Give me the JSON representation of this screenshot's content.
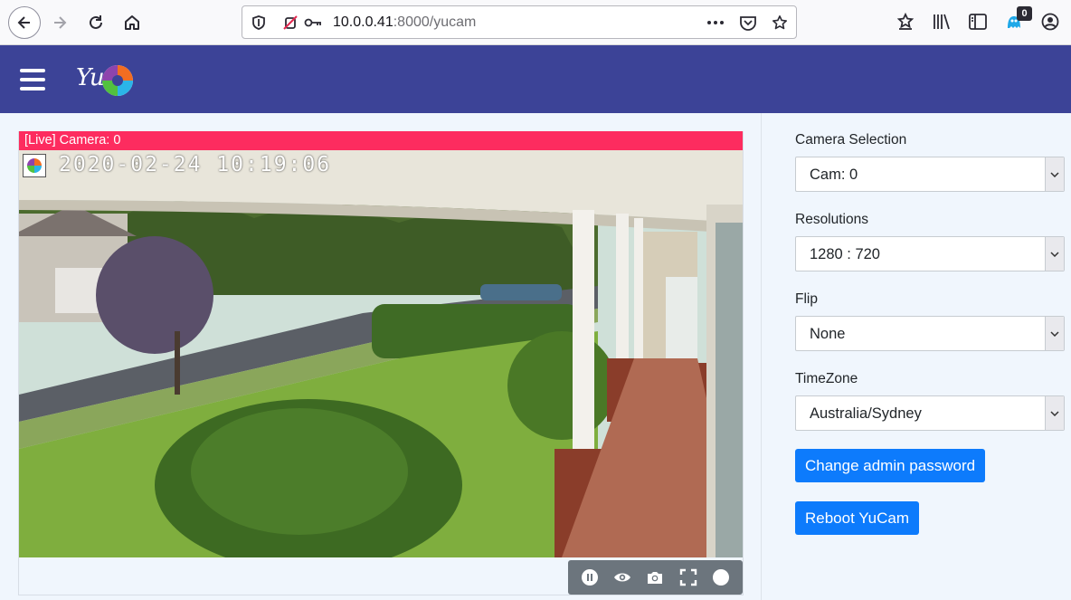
{
  "browser": {
    "url_host": "10.0.0.41",
    "url_path": ":8000/yucam",
    "extension_badge": "0"
  },
  "app": {
    "logo_text": "Yu"
  },
  "camera": {
    "live_label": "[Live] Camera: 0",
    "timestamp": "2020-02-24 10:19:06"
  },
  "sidebar": {
    "camera_selection_label": "Camera Selection",
    "camera_selection_value": "Cam: 0",
    "resolutions_label": "Resolutions",
    "resolutions_value": "1280 : 720",
    "flip_label": "Flip",
    "flip_value": "None",
    "timezone_label": "TimeZone",
    "timezone_value": "Australia/Sydney",
    "change_password_button": "Change admin password",
    "reboot_button": "Reboot YuCam"
  },
  "colors": {
    "appbar": "#3c4397",
    "live_bar": "#fd2c5f",
    "primary_button": "#0d7bfc",
    "controls_bg": "#6c757d"
  },
  "icons": [
    "back-icon",
    "forward-icon",
    "reload-icon",
    "home-icon",
    "shield-icon",
    "tracking-off-icon",
    "key-icon",
    "more-icon",
    "pocket-icon",
    "star-icon",
    "bookmark-star-icon",
    "library-icon",
    "sidebar-icon",
    "extension-icon",
    "account-icon",
    "menu-icon",
    "pause-icon",
    "eye-icon",
    "camera-icon",
    "fullscreen-icon",
    "record-icon"
  ]
}
